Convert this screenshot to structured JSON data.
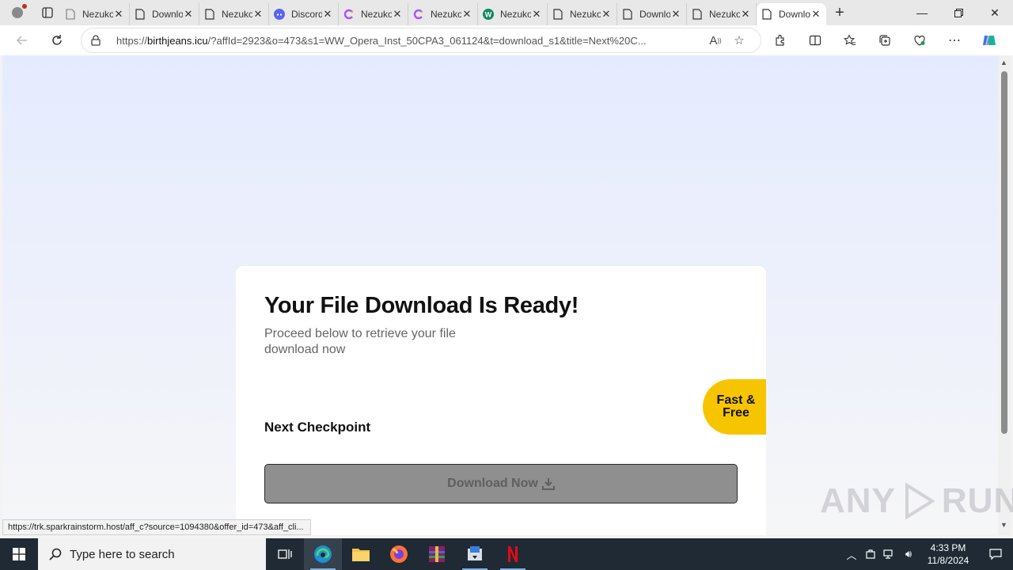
{
  "browser": {
    "tabs": [
      {
        "title": "Nezuko",
        "favicon": "blank-page-icon",
        "active": false
      },
      {
        "title": "Download",
        "favicon": "page-icon",
        "active": false
      },
      {
        "title": "Nezuko",
        "favicon": "page-icon",
        "active": false
      },
      {
        "title": "Discord",
        "favicon": "discord-icon",
        "active": false
      },
      {
        "title": "Nezuko",
        "favicon": "swirl-icon",
        "active": false
      },
      {
        "title": "Nezuko",
        "favicon": "swirl-icon",
        "active": false
      },
      {
        "title": "Nezuko",
        "favicon": "w-icon",
        "active": false
      },
      {
        "title": "Nezuko",
        "favicon": "page-icon",
        "active": false
      },
      {
        "title": "Download",
        "favicon": "page-icon",
        "active": false
      },
      {
        "title": "Nezuko",
        "favicon": "page-icon",
        "active": false
      },
      {
        "title": "Download",
        "favicon": "page-icon",
        "active": true
      }
    ],
    "address": {
      "prefix": "https://",
      "host": "birthjeans.icu",
      "rest": "/?affId=2923&o=473&s1=WW_Opera_Inst_50CPA3_061124&t=download_s1&title=Next%20C..."
    },
    "status_url": "https://trk.sparkrainstorm.host/aff_c?source=1094380&offer_id=473&aff_cli..."
  },
  "page": {
    "heading": "Your File Download Is Ready!",
    "subheading": "Proceed below to retrieve your file download now",
    "checkpoint": "Next Checkpoint",
    "badge_line1": "Fast &",
    "badge_line2": "Free",
    "download_label": "Download Now"
  },
  "watermark": {
    "left": "ANY",
    "right": "RUN"
  },
  "taskbar": {
    "search_placeholder": "Type here to search",
    "time": "4:33 PM",
    "date": "11/8/2024"
  },
  "colors": {
    "badge": "#f7c500",
    "download_button": "#8f8f8f",
    "taskbar": "#1f2a35"
  }
}
